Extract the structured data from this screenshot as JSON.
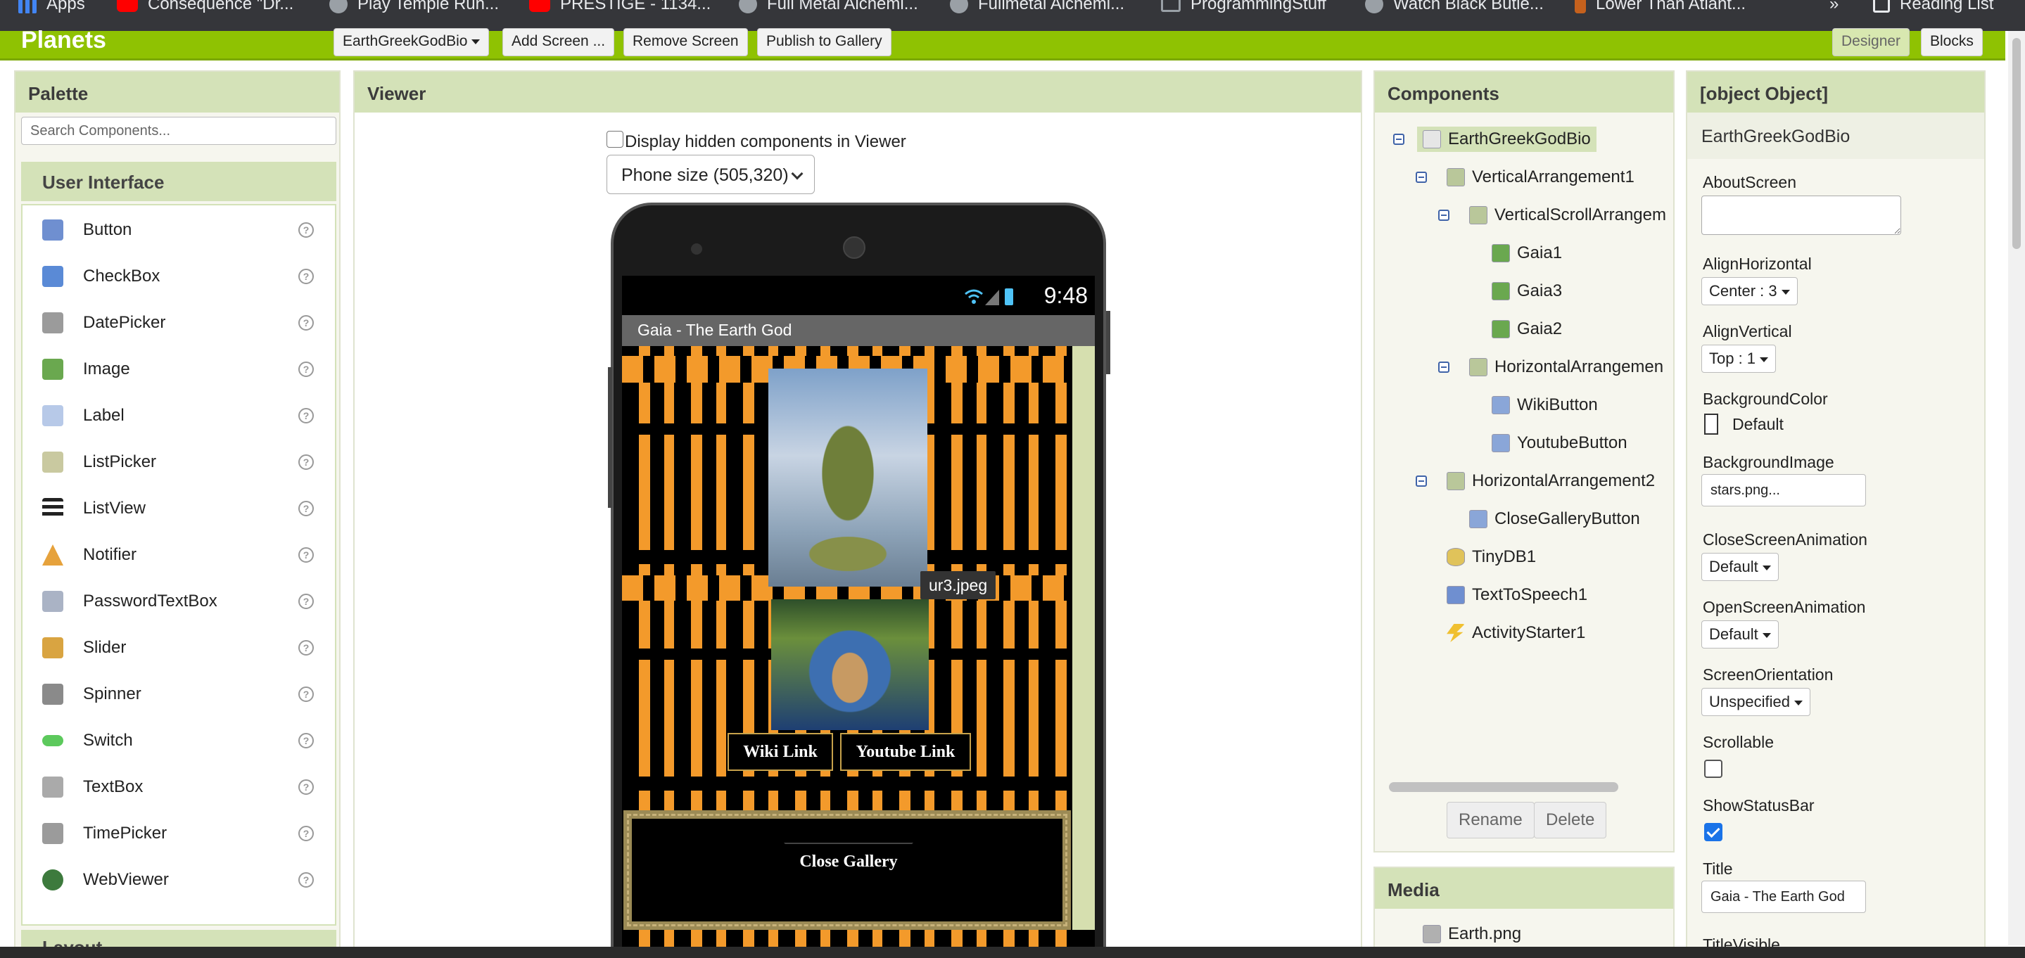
{
  "bookmarks": [
    {
      "label": "Apps",
      "icon": "apps-icon"
    },
    {
      "label": "Consequence \"Dr...",
      "icon": "youtube-icon"
    },
    {
      "label": "Play Temple Run...",
      "icon": "globe-icon"
    },
    {
      "label": "PRESTIGE - 1134...",
      "icon": "youtube-icon"
    },
    {
      "label": "Full Metal Alchemi...",
      "icon": "globe-icon"
    },
    {
      "label": "Fullmetal Alchemi...",
      "icon": "globe-icon"
    },
    {
      "label": "ProgrammingStuff",
      "icon": "folder-icon"
    },
    {
      "label": "Watch Black Butle...",
      "icon": "globe-icon"
    },
    {
      "label": "Lower Than Atlant...",
      "icon": "guitar-icon"
    },
    {
      "label": "»",
      "icon": ""
    },
    {
      "label": "Reading List",
      "icon": "reading-list-icon"
    }
  ],
  "toolbar": {
    "project_name": "Planets",
    "screen_select": "EarthGreekGodBio",
    "add_screen": "Add Screen ...",
    "remove_screen": "Remove Screen",
    "publish": "Publish to Gallery",
    "designer": "Designer",
    "blocks": "Blocks"
  },
  "palette": {
    "title": "Palette",
    "search_placeholder": "Search Components...",
    "category": "User Interface",
    "help_glyph": "?",
    "items": [
      {
        "label": "Button",
        "color": "#6f8fd0"
      },
      {
        "label": "CheckBox",
        "color": "#5a8ad6"
      },
      {
        "label": "DatePicker",
        "color": "#9b9b9b"
      },
      {
        "label": "Image",
        "color": "#6aa84f"
      },
      {
        "label": "Label",
        "color": "#b7c9e8"
      },
      {
        "label": "ListPicker",
        "color": "#c9c9a0"
      },
      {
        "label": "ListView",
        "color": "#222222"
      },
      {
        "label": "Notifier",
        "color": "#e6a23c"
      },
      {
        "label": "PasswordTextBox",
        "color": "#aab3c5"
      },
      {
        "label": "Slider",
        "color": "#d9a441"
      },
      {
        "label": "Spinner",
        "color": "#8a8a8a"
      },
      {
        "label": "Switch",
        "color": "#5cc95c"
      },
      {
        "label": "TextBox",
        "color": "#aaaaaa"
      },
      {
        "label": "TimePicker",
        "color": "#9b9b9b"
      },
      {
        "label": "WebViewer",
        "color": "#3d7a3d"
      }
    ],
    "next_category": "Layout"
  },
  "viewer": {
    "title": "Viewer",
    "hidden_label": "Display hidden components in Viewer",
    "size_option": "Phone size (505,320)",
    "clock": "9:48",
    "screen_title": "Gaia - The Earth God",
    "image_tooltip": "ur3.jpeg",
    "wiki_button": "Wiki Link",
    "youtube_button": "Youtube Link",
    "close_button": "Close Gallery"
  },
  "components": {
    "title": "Components",
    "tree": [
      {
        "label": "EarthGreekGodBio",
        "collapsible": true,
        "selected": true,
        "color": "#e6e6e6"
      },
      {
        "label": "VerticalArrangement1",
        "collapsible": true,
        "color": "#b9c79a"
      },
      {
        "label": "VerticalScrollArrangem",
        "collapsible": true,
        "color": "#b9c79a"
      },
      {
        "label": "Gaia1",
        "collapsible": false,
        "color": "#6aa84f"
      },
      {
        "label": "Gaia3",
        "collapsible": false,
        "color": "#6aa84f"
      },
      {
        "label": "Gaia2",
        "collapsible": false,
        "color": "#6aa84f"
      },
      {
        "label": "HorizontalArrangemen",
        "collapsible": true,
        "color": "#b9c79a"
      },
      {
        "label": "WikiButton",
        "collapsible": false,
        "color": "#8aa6d8"
      },
      {
        "label": "YoutubeButton",
        "collapsible": false,
        "color": "#8aa6d8"
      },
      {
        "label": "HorizontalArrangement2",
        "collapsible": true,
        "color": "#b9c79a"
      },
      {
        "label": "CloseGalleryButton",
        "collapsible": false,
        "color": "#8aa6d8"
      },
      {
        "label": "TinyDB1",
        "collapsible": false,
        "color": "#e0c35a"
      },
      {
        "label": "TextToSpeech1",
        "collapsible": false,
        "color": "#6f8fd0"
      },
      {
        "label": "ActivityStarter1",
        "collapsible": false,
        "color": "#f0c030"
      }
    ],
    "rename": "Rename",
    "delete": "Delete"
  },
  "media": {
    "title": "Media",
    "files": [
      "Earth.png"
    ]
  },
  "properties": {
    "title": {
      "label": "Title",
      "value": "Gaia - The Earth God"
    },
    "component": "EarthGreekGodBio",
    "about_screen": {
      "label": "AboutScreen",
      "value": ""
    },
    "align_horizontal": {
      "label": "AlignHorizontal",
      "value": "Center : 3"
    },
    "align_vertical": {
      "label": "AlignVertical",
      "value": "Top : 1"
    },
    "background_color": {
      "label": "BackgroundColor",
      "value": "Default"
    },
    "background_image": {
      "label": "BackgroundImage",
      "value": "stars.png..."
    },
    "close_animation": {
      "label": "CloseScreenAnimation",
      "value": "Default"
    },
    "open_animation": {
      "label": "OpenScreenAnimation",
      "value": "Default"
    },
    "orientation": {
      "label": "ScreenOrientation",
      "value": "Unspecified"
    },
    "scrollable": {
      "label": "Scrollable",
      "checked": false
    },
    "show_status_bar": {
      "label": "ShowStatusBar",
      "checked": true
    },
    "next_label": "TitleVisible"
  },
  "colors": {
    "accent_green": "#8fc202",
    "panel_header": "#d4e2b8"
  }
}
